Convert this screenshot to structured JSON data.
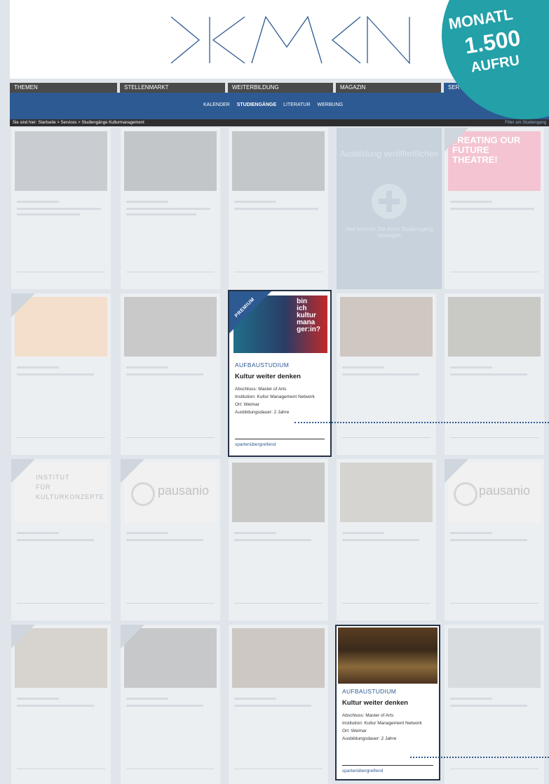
{
  "logo": {
    "icon": "kmn-logo"
  },
  "badge": {
    "line1": "MONATL",
    "line2": "1.500",
    "line3": "AUFRU",
    "color": "#23a0a8"
  },
  "nav": {
    "main": [
      "THEMEN",
      "STELLENMARKT",
      "WEITERBILDUNG",
      "MAGAZIN",
      "SERVICES"
    ],
    "sub": [
      "KALENDER",
      "STUDIENGÄNGE",
      "LITERATUR",
      "WERBUNG"
    ],
    "sub_active": "STUDIENGÄNGE"
  },
  "breadcrumb": {
    "text": "Sie sind hier: Startseite > Services > Studiengänge Kulturmanagement",
    "right_link": "Filter am Studiengang"
  },
  "ad_card": {
    "title": "Ausbildung veröffentlichen",
    "text": "Hier können Sie Ihren Studiengang eintragen"
  },
  "card_faded": {
    "top_right": "_REATING OUR FUTURE THEATRE!",
    "institut_logo": [
      "INSTITUT",
      "FÜR",
      "KULTURKONZEPTE"
    ],
    "pausanio_1": "pausanio",
    "pausanio_2": "pausanio"
  },
  "featured1": {
    "ribbon": "PREMIUM",
    "poster_text": [
      "bin",
      "ich",
      "kultur",
      "mana",
      "ger:in?"
    ],
    "category": "AUFBAUSTUDIUM",
    "title": "Kultur weiter denken",
    "meta": [
      "Abschluss: Master of Arts",
      "Institution: Kultur Management Network",
      "Ort: Weimar",
      "Ausbildungsdauer: 2 Jahre"
    ],
    "foot": "spartenübergreifend"
  },
  "featured2": {
    "category": "AUFBAUSTUDIUM",
    "title": "Kultur weiter denken",
    "meta": [
      "Abschluss: Master of Arts",
      "Institution: Kultur Management Network",
      "Ort: Weimar",
      "Ausbildungsdauer: 2 Jahre"
    ],
    "foot": "spartenübergreifend"
  },
  "colors": {
    "nav_blue": "#2d5a93",
    "dark_border": "#253246",
    "teal": "#23a0a8"
  }
}
